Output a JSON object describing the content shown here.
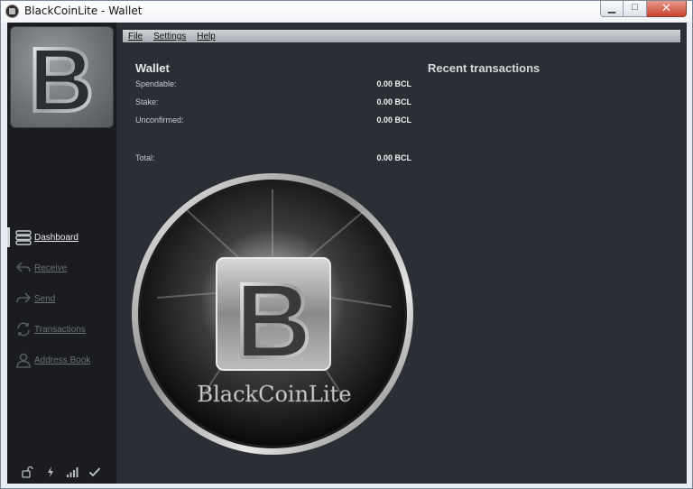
{
  "window": {
    "title": "BlackCoinLite - Wallet",
    "controls": {
      "minimize": "▁",
      "maximize": "□",
      "close": "✕"
    }
  },
  "menu": {
    "items": [
      {
        "label": "File"
      },
      {
        "label": "Settings"
      },
      {
        "label": "Help"
      }
    ]
  },
  "sidebar": {
    "logo_letter": "B",
    "nav": [
      {
        "label": "Dashboard",
        "icon": "dashboard-icon",
        "active": true
      },
      {
        "label": "Receive",
        "icon": "receive-icon",
        "active": false
      },
      {
        "label": "Send",
        "icon": "send-icon",
        "active": false
      },
      {
        "label": "Transactions",
        "icon": "transactions-icon",
        "active": false
      },
      {
        "label": "Address Book",
        "icon": "address-book-icon",
        "active": false
      }
    ],
    "status_icons": [
      "lock-icon",
      "staking-bolt-icon",
      "connections-signal-icon",
      "synced-check-icon"
    ]
  },
  "wallet": {
    "title": "Wallet",
    "rows": [
      {
        "label": "Spendable:",
        "value": "0.00 BCL"
      },
      {
        "label": "Stake:",
        "value": "0.00 BCL"
      },
      {
        "label": "Unconfirmed:",
        "value": "0.00 BCL"
      },
      {
        "label": "Total:",
        "value": "0.00 BCL"
      }
    ]
  },
  "recent": {
    "title": "Recent transactions"
  },
  "coin": {
    "letter": "B",
    "wordmark": "BlackCoinLite"
  },
  "colors": {
    "background": "#2b2e34",
    "sidebar": "#1a1c20",
    "text": "#e6e8eb",
    "muted_nav": "#6d7178"
  }
}
